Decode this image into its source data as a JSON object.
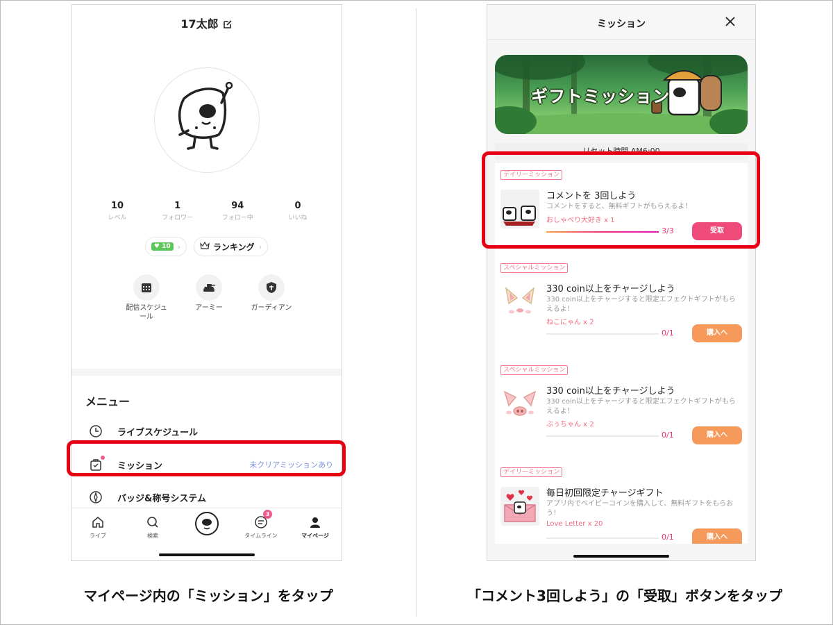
{
  "left": {
    "username": "17太郎",
    "stats": [
      {
        "num": "10",
        "label": "レベル"
      },
      {
        "num": "1",
        "label": "フォロワー"
      },
      {
        "num": "94",
        "label": "フォロー中"
      },
      {
        "num": "0",
        "label": "いいね"
      }
    ],
    "chips": {
      "level": "10",
      "ranking": "ランキング"
    },
    "quick": [
      {
        "label": "配信スケジュール",
        "icon": "calendar-icon"
      },
      {
        "label": "アーミー",
        "icon": "tank-icon"
      },
      {
        "label": "ガーディアン",
        "icon": "shield-icon"
      }
    ],
    "menu": {
      "title": "メニュー",
      "items": [
        {
          "label": "ライブスケジュール",
          "status": "",
          "icon": "clock-icon"
        },
        {
          "label": "ミッション",
          "status": "未クリアミッションあり",
          "icon": "mission-bag-icon"
        },
        {
          "label": "バッジ&称号システム",
          "status": "",
          "icon": "badge-icon"
        }
      ]
    },
    "tabs": [
      {
        "label": "ライブ",
        "icon": "home-icon"
      },
      {
        "label": "検索",
        "icon": "search-icon"
      },
      {
        "label": "",
        "icon": "camera-center-icon"
      },
      {
        "label": "タイムライン",
        "icon": "timeline-icon",
        "badge": "3"
      },
      {
        "label": "マイページ",
        "icon": "person-icon"
      }
    ]
  },
  "right": {
    "header_title": "ミッション",
    "banner_title": "ギフトミッション",
    "reset_text": "リセット時間 AM6:00",
    "missions": [
      {
        "tag": "デイリーミッション",
        "name": "コメントを 3回しよう",
        "desc": "コメントをすると、無料ギフトがもらえるよ！",
        "reward": "おしゃべり大好き x 1",
        "progress_text": "3/3",
        "progress": 1.0,
        "button": "受取",
        "button_style": "pink"
      },
      {
        "tag": "スペシャルミッション",
        "name": "330 coin以上をチャージしよう",
        "desc": "330 coin以上をチャージすると限定エフェクトギフトがもらえるよ！",
        "reward": "ねこにゃん x 2",
        "progress_text": "0/1",
        "progress": 0.0,
        "button": "購入へ",
        "button_style": "orange"
      },
      {
        "tag": "スペシャルミッション",
        "name": "330 coin以上をチャージしよう",
        "desc": "330 coin以上をチャージすると限定エフェクトギフトがもらえるよ！",
        "reward": "ぶぅちゃん x 2",
        "progress_text": "0/1",
        "progress": 0.0,
        "button": "購入へ",
        "button_style": "orange"
      },
      {
        "tag": "デイリーミッション",
        "name": "毎日初回限定チャージギフト",
        "desc": "アプリ内でベイビーコインを購入して、無料ギフトをもらおう！",
        "reward": "Love Letter x 20",
        "progress_text": "0/1",
        "progress": 0.0,
        "button": "購入へ",
        "button_style": "orange"
      }
    ]
  },
  "captions": {
    "left": "マイページ内の「ミッション」をタップ",
    "right": "「コメント3回しよう」の「受取」ボタンをタップ"
  },
  "colors": {
    "highlight": "#e50012",
    "accent_pink": "#ee4a7a",
    "accent_orange": "#f69a5b",
    "tag_pink": "#f37a8f",
    "status_blue": "#7b93d9"
  }
}
